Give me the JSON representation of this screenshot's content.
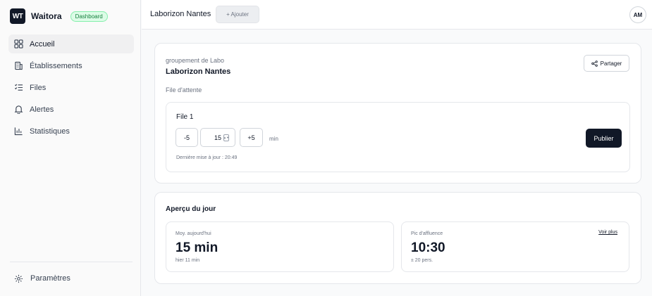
{
  "app": {
    "logo_text": "WT",
    "name": "Waitora",
    "badge": "Dashboard"
  },
  "sidebar": {
    "items": [
      {
        "label": "Accueil",
        "icon": "grid-icon",
        "active": true
      },
      {
        "label": "Établissements",
        "icon": "building-icon",
        "active": false
      },
      {
        "label": "Files",
        "icon": "list-icon",
        "active": false
      },
      {
        "label": "Alertes",
        "icon": "bell-icon",
        "active": false
      },
      {
        "label": "Statistiques",
        "icon": "bar-chart-icon",
        "active": false
      }
    ],
    "settings_label": "Paramètres"
  },
  "header": {
    "title": "Laborizon Nantes",
    "add_label": "+ Ajouter",
    "avatar": "AM"
  },
  "establishment": {
    "group_label": "groupement de Labo",
    "name": "Laborizon Nantes",
    "share_label": "Partager",
    "queue_section_label": "File d'attente"
  },
  "queue": {
    "title": "File 1",
    "minus_label": "-5",
    "value": "15",
    "plus_label": "+5",
    "unit": "min",
    "last_update": "Dernière mise à jour : 20:49",
    "publish_label": "Publier"
  },
  "day_overview": {
    "title": "Aperçu du jour",
    "average": {
      "label": "Moy. aujourd'hui",
      "value": "15 min",
      "sub": "hier 11 min"
    },
    "peak": {
      "label": "Pic d'affluence",
      "value": "10:30",
      "sub": "± 20 pers.",
      "link": "Voir plus"
    }
  },
  "colors": {
    "primary": "#111827",
    "badge_bg": "#dcfce7",
    "badge_text": "#15803d"
  }
}
